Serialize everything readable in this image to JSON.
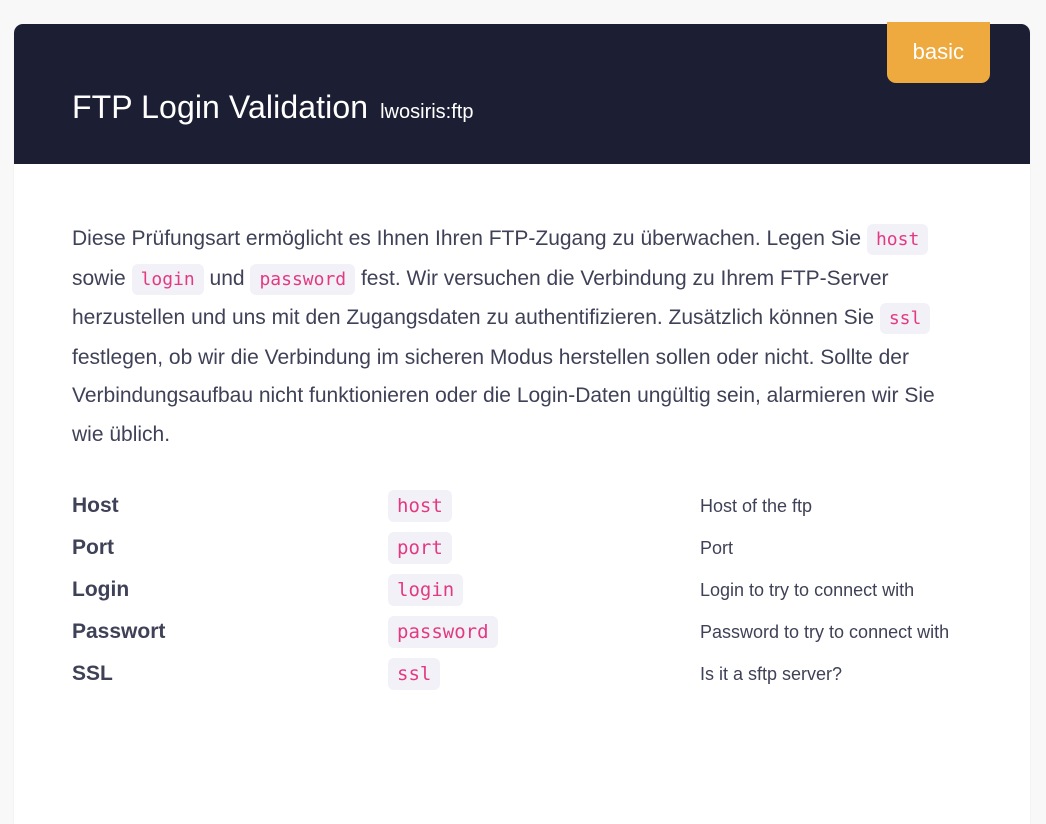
{
  "page": {
    "background_color": "#f8f8f9",
    "card_background": "#ffffff"
  },
  "header": {
    "background_color": "#1c1f33",
    "title": "FTP Login Validation",
    "subtitle": "lwosiris:ftp",
    "badge": {
      "label": "basic",
      "color": "#eea93f",
      "text_color": "#ffffff"
    }
  },
  "content": {
    "intro": {
      "segments": [
        {
          "type": "text",
          "value": "Diese Prüfungsart ermöglicht es Ihnen Ihren FTP-Zugang zu überwachen. Legen Sie "
        },
        {
          "type": "code",
          "value": "host"
        },
        {
          "type": "text",
          "value": " sowie "
        },
        {
          "type": "code",
          "value": "login"
        },
        {
          "type": "text",
          "value": " und "
        },
        {
          "type": "code",
          "value": "password"
        },
        {
          "type": "text",
          "value": " fest. Wir versuchen die Verbindung zu Ihrem FTP-Server herzustellen und uns mit den Zugangsdaten zu authentifizieren. Zusätzlich können Sie "
        },
        {
          "type": "code",
          "value": "ssl"
        },
        {
          "type": "text",
          "value": " festlegen, ob wir die Verbindung im sicheren Modus herstellen sollen oder nicht. Sollte der Verbindungsaufbau nicht funktionieren oder die Login-Daten ungültig sein, alarmieren wir Sie wie üblich."
        }
      ],
      "text_part_1": "Diese Prüfungsart ermöglicht es Ihnen Ihren FTP-Zugang zu überwachen. Legen Sie ",
      "code_1": "host",
      "text_part_2": " sowie ",
      "code_2": "login",
      "text_part_3": " und ",
      "code_3": "password",
      "text_part_4": " fest. Wir versuchen die Verbindung zu Ihrem FTP-Server herzustellen und uns mit den Zugangsdaten zu authentifizieren. Zusätzlich können Sie ",
      "code_4": "ssl",
      "text_part_5": " festlegen, ob wir die Verbindung im sicheren Modus herstellen sollen oder nicht. Sollte der Verbindungsaufbau nicht funktionieren oder die Login-Daten ungültig sein, alarmieren wir Sie wie üblich."
    },
    "params": {
      "code_chip_bg": "#f2f1f7",
      "code_chip_color": "#e23a82",
      "rows": [
        {
          "label": "Host",
          "code": "host",
          "description": "Host of the ftp"
        },
        {
          "label": "Port",
          "code": "port",
          "description": "Port"
        },
        {
          "label": "Login",
          "code": "login",
          "description": "Login to try to connect with"
        },
        {
          "label": "Passwort",
          "code": "password",
          "description": "Password to try to connect with"
        },
        {
          "label": "SSL",
          "code": "ssl",
          "description": "Is it a sftp server?"
        }
      ]
    }
  }
}
